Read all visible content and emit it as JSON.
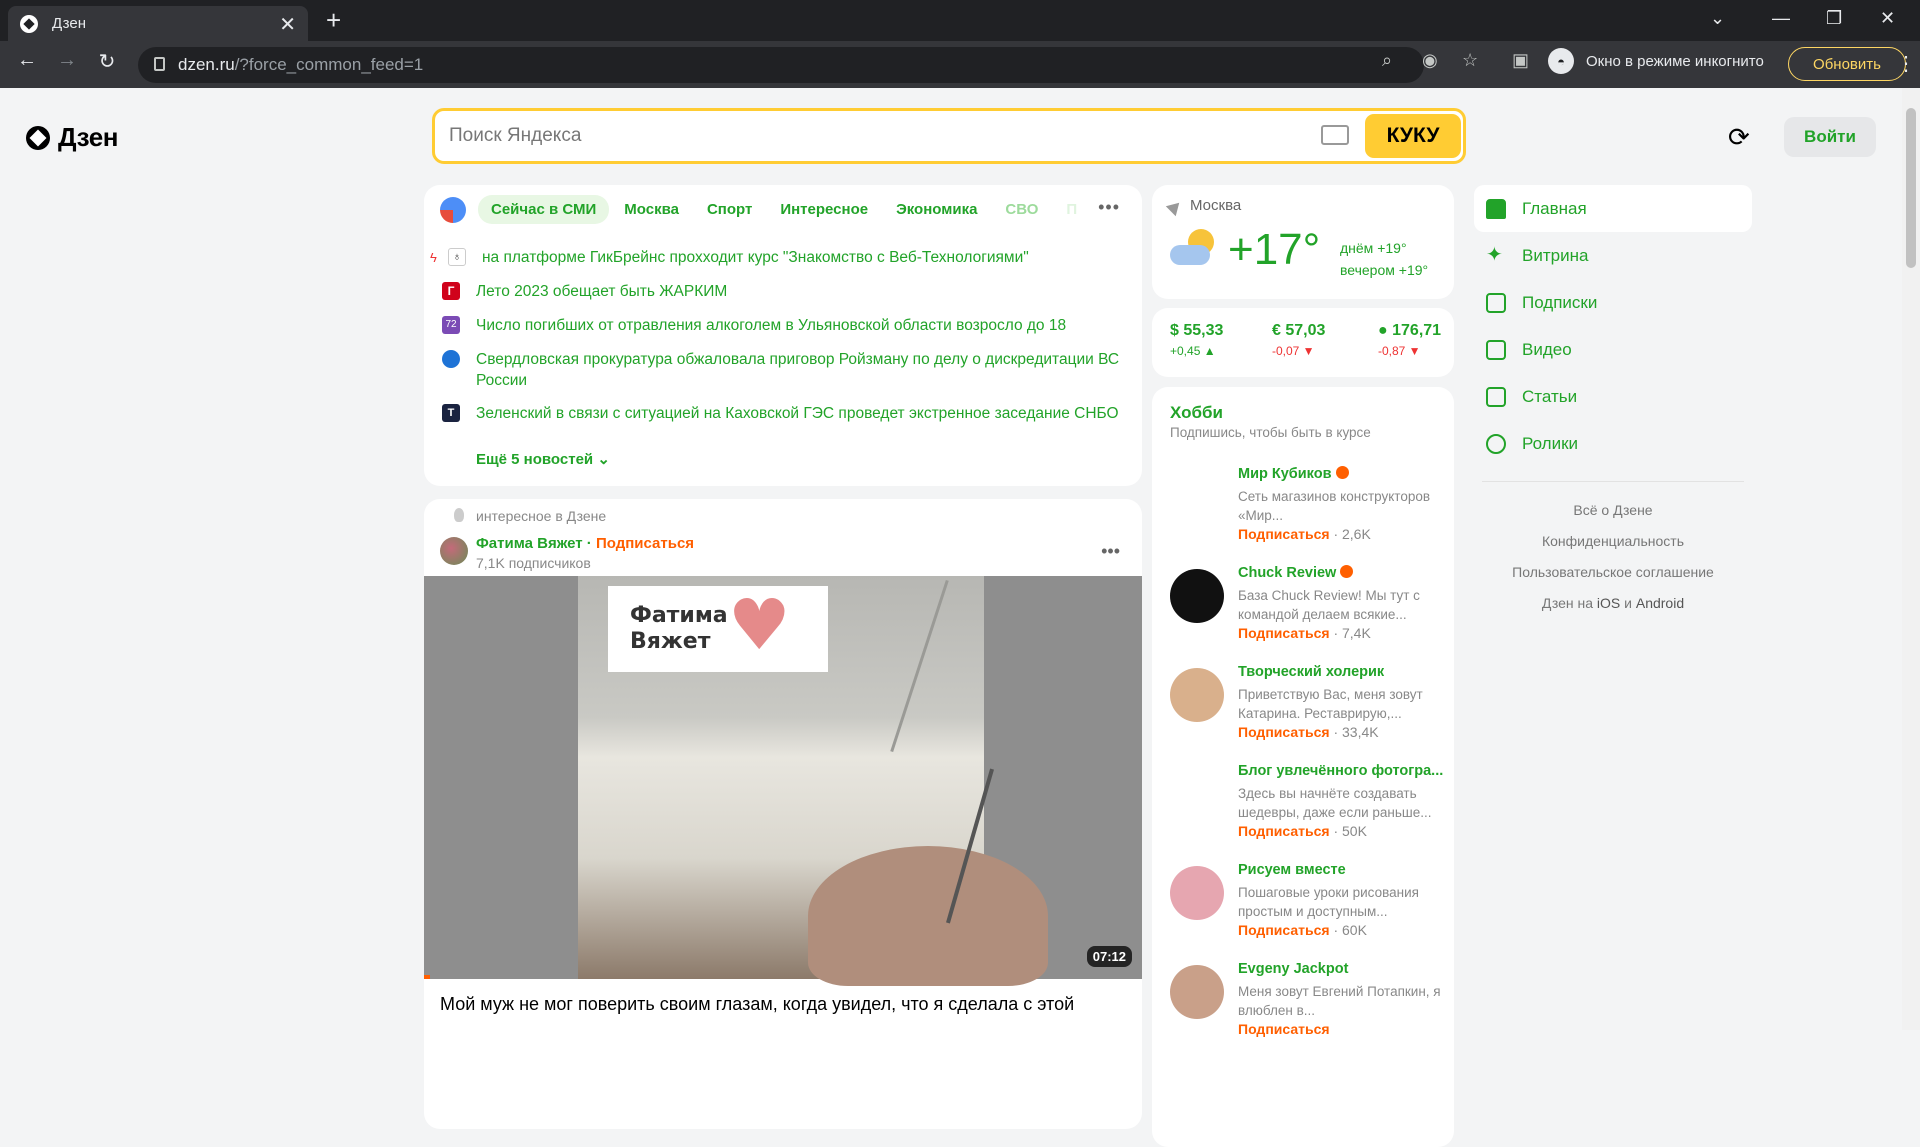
{
  "browser": {
    "tab_title": "Дзен",
    "url_domain": "dzen.ru",
    "url_rest": "/?force_common_feed=1",
    "incognito_label": "Окно в режиме инкогнито",
    "update_label": "Обновить"
  },
  "header": {
    "logo": "Дзен",
    "search_placeholder": "Поиск Яндекса",
    "search_button": "КУКУ",
    "login": "Войти"
  },
  "news": {
    "tabs": [
      "Сейчас в СМИ",
      "Москва",
      "Спорт",
      "Интересное",
      "Экономика",
      "СВО",
      "П"
    ],
    "items": [
      {
        "text": "на платформе ГикБрейнс прохходит курс \"Знакомство с Веб-Технологиями\"",
        "color": "#ffffff",
        "mark": "#333333"
      },
      {
        "text": "Лето 2023 обещает быть ЖАРКИМ",
        "color": "#d0021b",
        "mark": "#ffffff"
      },
      {
        "text": "Число погибших от отравления алкоголем в Ульяновской области возросло до 18",
        "color": "#7b4bb5",
        "mark": "#ffffff"
      },
      {
        "text": "Свердловская прокуратура обжаловала приговор Ройзману по делу о дискредитации ВС России",
        "color": "#1e73d6",
        "mark": "#ffffff"
      },
      {
        "text": "Зеленский в связи с ситуацией на Каховской ГЭС проведет экстренное заседание СНБО",
        "color": "#1a2340",
        "mark": "#ffffff"
      }
    ],
    "more": "Ещё 5 новостей"
  },
  "article": {
    "header": "интересное в Дзене",
    "author": "Фатима Вяжет",
    "subscribe": "Подписаться",
    "subscribers": "7,1K подписчиков",
    "video_label": "Фатима\nВяжет",
    "duration": "07:12",
    "title": "Мой муж не мог поверить своим глазам, когда увидел, что я сделала с этой"
  },
  "weather": {
    "city": "Москва",
    "temp": "+17°",
    "day": "днём +19°",
    "evening": "вечером +19°"
  },
  "rates": [
    {
      "value": "$ 55,33",
      "delta": "+0,45 ▲",
      "dir": "up"
    },
    {
      "value": "€ 57,03",
      "delta": "-0,07 ▼",
      "dir": "dn"
    },
    {
      "value": "176,71",
      "delta": "-0,87 ▼",
      "dir": "dn"
    }
  ],
  "hobby": {
    "title": "Хобби",
    "subtitle": "Подпишись, чтобы быть в курсе",
    "channels": [
      {
        "name": "Мир Кубиков",
        "verified": true,
        "desc": "Сеть магазинов конструкторов «Мир...",
        "action": "Подписаться",
        "count": "2,6K",
        "bg": "#ffffff",
        "fg": "#e31e24"
      },
      {
        "name": "Chuck Review",
        "verified": true,
        "desc": "База Chuck Review! Мы тут с командой делаем всякие...",
        "action": "Подписаться",
        "count": "7,4K",
        "bg": "#111111",
        "fg": "#f6a21b"
      },
      {
        "name": "Творческий холерик",
        "verified": false,
        "desc": "Приветствую Вас, меня зовут Катарина. Реставрирую,...",
        "action": "Подписаться",
        "count": "33,4K",
        "bg": "#d9b08c",
        "fg": "#6b4a2e"
      },
      {
        "name": "Блог увлечённого фотогра...",
        "verified": false,
        "desc": "Здесь вы начнёте создавать шедевры, даже если раньше...",
        "action": "Подписаться",
        "count": "50K",
        "bg": "#ffffff",
        "fg": "#333333"
      },
      {
        "name": "Рисуем вместе",
        "verified": false,
        "desc": "Пошаговые уроки рисования простым и доступным...",
        "action": "Подписаться",
        "count": "60K",
        "bg": "#e6a6b0",
        "fg": "#2f7a3d"
      },
      {
        "name": "Evgeny Jackpot",
        "verified": false,
        "desc": "Меня зовут Евгений Потапкин, я влюблен в...",
        "action": "Подписаться",
        "count": "",
        "bg": "#c9a089",
        "fg": "#5a3a2a"
      }
    ]
  },
  "nav": {
    "items": [
      "Главная",
      "Витрина",
      "Подписки",
      "Видео",
      "Статьи",
      "Ролики"
    ],
    "footer": [
      "Всё о Дзене",
      "Конфиденциальность",
      "Пользовательское соглашение"
    ],
    "platforms_prefix": "Дзен на",
    "ios": "iOS",
    "and": "и",
    "android": "Android"
  },
  "colors": {
    "accent": "#22a329",
    "search_yellow": "#ffcc33",
    "subscribe_orange": "#ff5f00"
  }
}
